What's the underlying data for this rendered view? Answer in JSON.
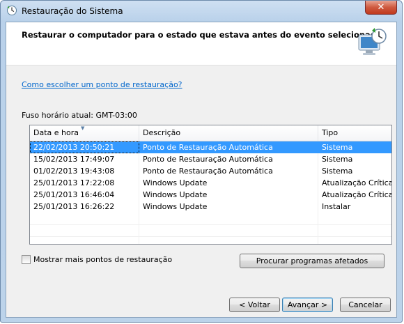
{
  "window": {
    "title": "Restauração do Sistema",
    "close_glyph": "✕"
  },
  "header": {
    "text": "Restaurar o computador para o estado que estava antes do evento selecionado",
    "icon": "system-restore-icon"
  },
  "link_text": "Como escolher um ponto de restauração?",
  "timezone_label": "Fuso horário atual: GMT-03:00",
  "table": {
    "columns": [
      "Data e hora",
      "Descrição",
      "Tipo"
    ],
    "rows": [
      {
        "date": "22/02/2013 20:50:21",
        "desc": "Ponto de Restauração Automática",
        "type": "Sistema"
      },
      {
        "date": "15/02/2013 17:49:07",
        "desc": "Ponto de Restauração Automática",
        "type": "Sistema"
      },
      {
        "date": "01/02/2013 19:43:08",
        "desc": "Ponto de Restauração Automática",
        "type": "Sistema"
      },
      {
        "date": "25/01/2013 17:22:08",
        "desc": "Windows Update",
        "type": "Atualização Crítica"
      },
      {
        "date": "25/01/2013 16:46:04",
        "desc": "Windows Update",
        "type": "Atualização Crítica"
      },
      {
        "date": "25/01/2013 16:26:22",
        "desc": "Windows Update",
        "type": "Instalar"
      }
    ],
    "selected_index": 0
  },
  "checkbox_label": "Mostrar mais pontos de restauração",
  "buttons": {
    "scan": "Procurar programas afetados",
    "back": "< Voltar",
    "next": "Avançar >",
    "cancel": "Cancelar"
  },
  "colors": {
    "selection": "#3399ff",
    "link": "#0066cc",
    "close": "#c0391d"
  }
}
